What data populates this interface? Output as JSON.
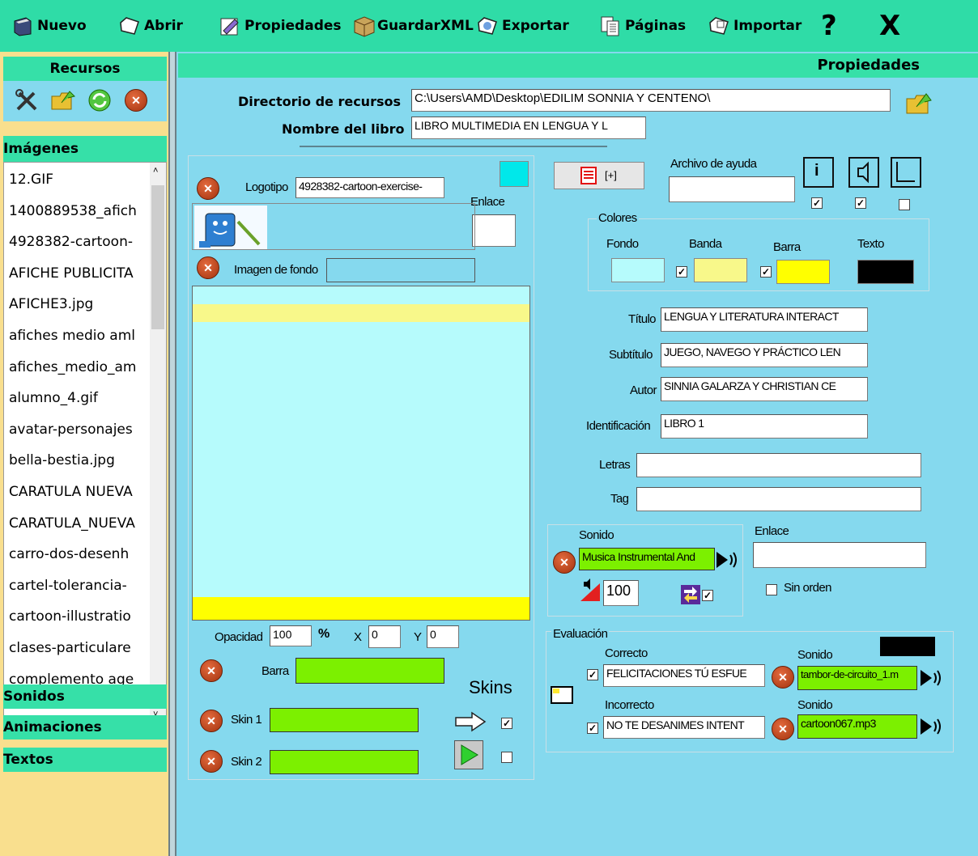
{
  "toolbar": {
    "nuevo": "Nuevo",
    "abrir": "Abrir",
    "propiedades": "Propiedades",
    "guardar": "GuardarXML",
    "exportar": "Exportar",
    "paginas": "Páginas",
    "importar": "Importar",
    "help": "?",
    "close": "X"
  },
  "sidebar": {
    "recursos": "Recursos",
    "imagenes": "Imágenes",
    "sonidos": "Sonidos",
    "animaciones": "Animaciones",
    "textos": "Textos",
    "files": [
      "12.GIF",
      "1400889538_afich",
      "4928382-cartoon-",
      "AFICHE PUBLICITA",
      "AFICHE3.jpg",
      "afiches medio aml",
      "afiches_medio_am",
      "alumno_4.gif",
      "avatar-personajes",
      "bella-bestia.jpg",
      "CARATULA NUEVA",
      "CARATULA_NUEVA",
      "carro-dos-desenh",
      "cartel-tolerancia-",
      "cartoon-illustratio",
      "clases-particulare",
      "complemento age"
    ]
  },
  "main": {
    "title": "Propiedades",
    "dir_label": "Directorio de recursos",
    "dir_value": "C:\\Users\\AMD\\Desktop\\EDILIM SONNIA Y  CENTENO\\",
    "book_label": "Nombre del libro",
    "book_value": "LIBRO MULTIMEDIA EN LENGUA Y L",
    "logo_label": "Logotipo",
    "logo_value": "4928382-cartoon-exercise-",
    "enlace": "Enlace",
    "fondo_label": "Imagen de fondo",
    "opacidad_label": "Opacidad",
    "opacidad_value": "100",
    "percent": "%",
    "x_label": "X",
    "x_value": "0",
    "y_label": "Y",
    "y_value": "0",
    "barra_label": "Barra",
    "skins": "Skins",
    "skin1": "Skin 1",
    "skin2": "Skin 2",
    "pages_btn": "[+]",
    "ayuda_label": "Archivo de ayuda",
    "info_btn": "i",
    "colores": "Colores",
    "c_fondo": "Fondo",
    "c_banda": "Banda",
    "c_barra": "Barra",
    "c_texto": "Texto",
    "titulo_label": "Título",
    "titulo_value": "LENGUA Y LITERATURA INTERACT",
    "subtitulo_label": "Subtítulo",
    "subtitulo_value": "JUEGO, NAVEGO Y PRÁCTICO LEN",
    "autor_label": "Autor",
    "autor_value": "SINNIA GALARZA Y CHRISTIAN CE",
    "ident_label": "Identificación",
    "ident_value": "LIBRO 1",
    "letras_label": "Letras",
    "tag_label": "Tag",
    "sonido_label": "Sonido",
    "sonido_value": "Musica Instrumental And",
    "volume": "100",
    "enlace2": "Enlace",
    "sin_orden": "Sin orden",
    "evaluacion": "Evaluación",
    "correcto_label": "Correcto",
    "correcto_value": "FELICITACIONES TÚ ESFUE",
    "correcto_sonido_label": "Sonido",
    "correcto_sonido_value": "tambor-de-circuito_1.m",
    "incorrecto_label": "Incorrecto",
    "incorrecto_value": "NO TE DESANIMES INTENT",
    "incorrecto_sonido_label": "Sonido",
    "incorrecto_sonido_value": "cartoon067.mp3"
  },
  "colors": {
    "background": "#85d9ee",
    "toolbar": "#2fdca7",
    "sidebar": "#f9df8e",
    "preview_fondo": "#b6fbfc",
    "preview_banda": "#f8f88a",
    "preview_barra": "#ffff00",
    "texto": "#000000",
    "green_field": "#7cf000"
  }
}
